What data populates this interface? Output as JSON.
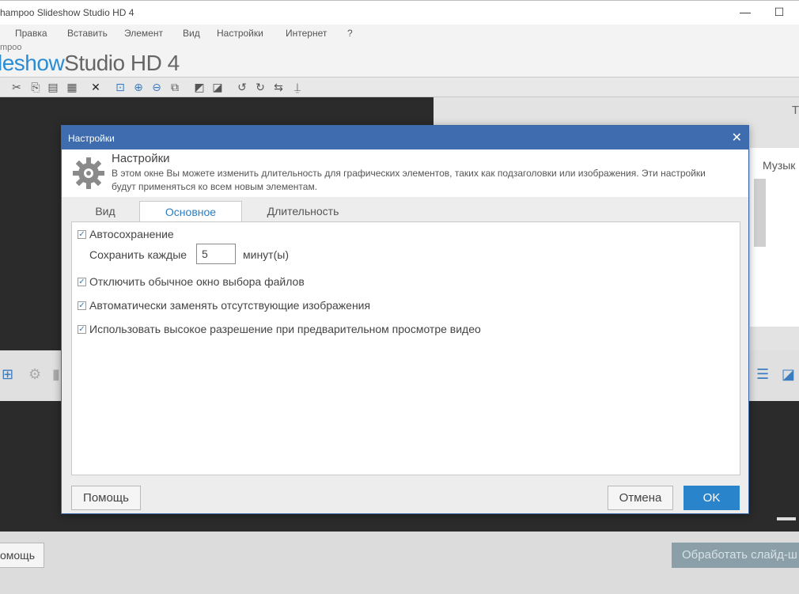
{
  "window": {
    "title": "hampoo Slideshow Studio HD 4",
    "minimize": "—",
    "maximize": "☐"
  },
  "menu": [
    "Правка",
    "Вставить",
    "Элемент",
    "Вид",
    "Настройки",
    "Интернет",
    "?"
  ],
  "brand": {
    "small": "mpoo",
    "logo_a": "leshow",
    "logo_b": "Studio HD",
    "logo_num": " 4"
  },
  "toolbar_icons": [
    "cut-icon",
    "copy-icon",
    "paste-icon",
    "layers-icon",
    "delete-icon",
    "zoom-fit-icon",
    "zoom-in-icon",
    "zoom-out-icon",
    "zoom-box-icon",
    "move-back-icon",
    "move-front-icon",
    "rotate-left-icon",
    "rotate-right-icon",
    "flip-icon",
    "stamp-icon"
  ],
  "right_panel": {
    "tab_letter": "Т",
    "music_label": "Музык"
  },
  "footer": {
    "help_label": "омощь",
    "process_label": "Обработать слайд-ш"
  },
  "dialog": {
    "title": "Настройки",
    "header_title": "Настройки",
    "header_desc": "В этом окне Вы можете изменить длительность для графических элементов, таких как подзаголовки или изображения. Эти настройки будут применяться ко всем новым элементам.",
    "tabs": [
      {
        "label": "Вид",
        "active": false
      },
      {
        "label": "Основное",
        "active": true
      },
      {
        "label": "Длительность",
        "active": false
      }
    ],
    "options": {
      "autosave_label": "Автосохранение",
      "autosave_checked": true,
      "save_every_label": "Сохранить каждые",
      "save_every_value": "5",
      "minutes_label": "минут(ы)",
      "disable_file_dialog_label": "Отключить обычное окно выбора файлов",
      "disable_file_dialog_checked": true,
      "replace_missing_label": "Автоматически заменять отсутствующие изображения",
      "replace_missing_checked": true,
      "high_res_preview_label": "Использовать высокое разрешение при предварительном просмотре видео",
      "high_res_preview_checked": true
    },
    "buttons": {
      "help": "Помощь",
      "cancel": "Отмена",
      "ok": "OK"
    },
    "colors": {
      "title_bar": "#3f6cae",
      "accent": "#2a7ec2",
      "ok_button": "#2a84cc"
    }
  }
}
